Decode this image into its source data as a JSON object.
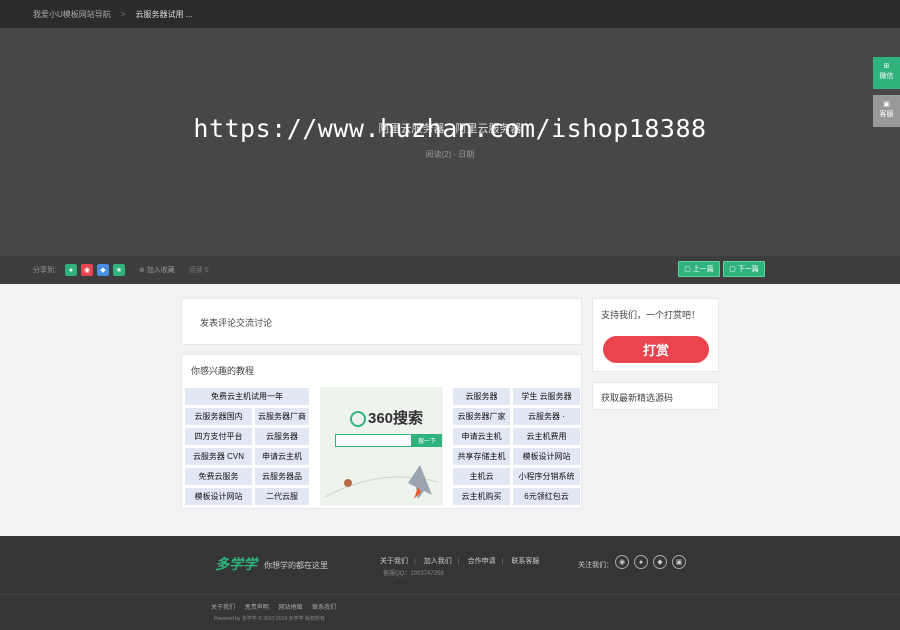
{
  "topbar": {
    "home": "我爱小U模板网站导航",
    "separator": ">",
    "current": "云服务器试用 ..."
  },
  "hero": {
    "title_a": "阿里云服务器",
    "title_b": "阿里云服务器",
    "watermark": "https://www.huzhan.com/ishop18388",
    "meta": "阅读(2) · 日期"
  },
  "side": {
    "a_icon": "⊞",
    "a_label": "微信",
    "b_icon": "▣",
    "b_label": "客服"
  },
  "share": {
    "label": "分享到：",
    "fav": "加入收藏",
    "views": "阅读 0",
    "prev": "上一篇",
    "next": "下一篇"
  },
  "comment": {
    "title": "发表评论交流讨论"
  },
  "interest": {
    "title": "你感兴趣的教程",
    "left_full": "免费云主机试用一年",
    "left_rows": [
      [
        "云服务器国内",
        "云服务器厂商"
      ],
      [
        "四方支付平台",
        "云服务器"
      ],
      [
        "云服务器 CVN",
        "申请云主机"
      ],
      [
        "免费云服务",
        "云服务器品"
      ],
      [
        "模板设计网站",
        "二代云服"
      ]
    ],
    "right_rows": [
      [
        "云服务器",
        "学生 云服务器"
      ],
      [
        "云服务器厂家",
        "云服务器 ·"
      ],
      [
        "申请云主机",
        "云主机费用"
      ],
      [
        "共享存储主机",
        "模板设计网站"
      ],
      [
        "主机云",
        "小程序分销系统"
      ],
      [
        "云主机购买",
        "6元领红包云"
      ]
    ]
  },
  "ad": {
    "logo": "360搜索",
    "btn": "搜一下"
  },
  "support": {
    "title": "支持我们，一个打赏吧！",
    "btn": "打赏"
  },
  "download": {
    "title": "获取最新精选源码"
  },
  "footer": {
    "brand": "多学学",
    "slogan": "你想学的都在这里",
    "links": [
      "关于我们",
      "加入我们",
      "合作申请",
      "联系客服"
    ],
    "number": "客服QQ：1903747258",
    "follow": "关注我们：",
    "bottom": [
      "关于我们",
      "免责声明",
      "网站地图",
      "联系我们"
    ],
    "copyright": "Powered by 多学学 © 2017-2019 多学学 版权所有"
  },
  "colors": {
    "accent": "#2fb37b",
    "reward": "#e9444f"
  }
}
